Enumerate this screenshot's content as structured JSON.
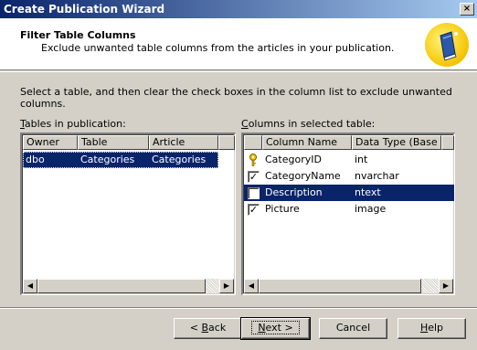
{
  "window": {
    "title": "Create Publication Wizard",
    "close_glyph": "×"
  },
  "header": {
    "title": "Filter Table Columns",
    "subtitle": "Exclude unwanted table columns from the articles in your publication.",
    "icon": "book-wizard-icon"
  },
  "instruction": "Select a table, and then clear the check boxes in the column list to exclude unwanted columns.",
  "tables_panel": {
    "label_accel": "T",
    "label_rest": "ables in publication:",
    "headers": [
      "Owner",
      "Table",
      "Article"
    ],
    "rows": [
      {
        "owner": "dbo",
        "table": "Categories",
        "article": "Categories",
        "selected": true
      }
    ]
  },
  "columns_panel": {
    "label_accel": "C",
    "label_rest": "olumns in selected table:",
    "headers": [
      "Column Name",
      "Data Type (Base ..."
    ],
    "rows": [
      {
        "name": "CategoryID",
        "type": "int",
        "checked": true,
        "primary_key": true
      },
      {
        "name": "CategoryName",
        "type": "nvarchar",
        "checked": true,
        "primary_key": false
      },
      {
        "name": "Description",
        "type": "ntext",
        "checked": false,
        "primary_key": false,
        "selected": true
      },
      {
        "name": "Picture",
        "type": "image",
        "checked": true,
        "primary_key": false
      }
    ]
  },
  "buttons": {
    "back_accel": "B",
    "back_pre": "< ",
    "back_rest": "ack",
    "next_accel": "N",
    "next_rest": "ext >",
    "cancel": "Cancel",
    "help_accel": "H",
    "help_rest": "elp"
  },
  "icons": {
    "left_arrow": "◀",
    "right_arrow": "▶",
    "check": "✓"
  },
  "colors": {
    "selection": "#0a246a",
    "face": "#d4d0c8"
  }
}
